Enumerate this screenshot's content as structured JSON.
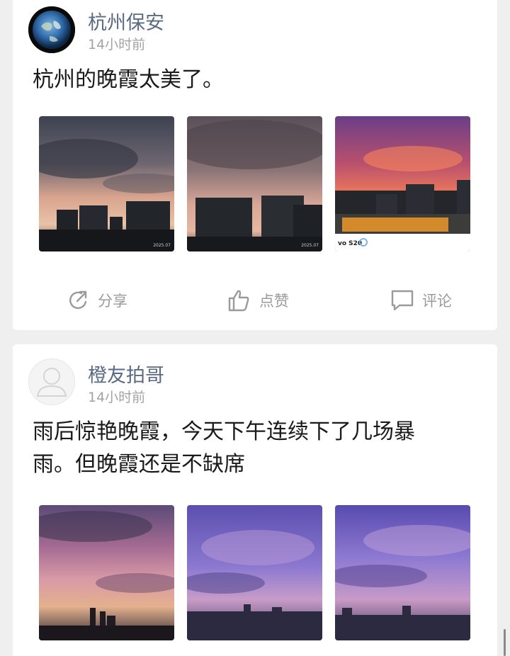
{
  "posts": [
    {
      "username": "杭州保安",
      "time": "14小时前",
      "content": "杭州的晚霞太美了。",
      "photo_captions": [
        "2025.07",
        "2025.07",
        "vo S20"
      ],
      "actions": {
        "share": "分享",
        "like": "点赞",
        "comment": "评论"
      }
    },
    {
      "username": "橙友拍哥",
      "time": "14小时前",
      "content_line1": "雨后惊艳晚霞，今天下午连续下了几场暴",
      "content_line2": "雨。但晚霞还是不缺席"
    }
  ],
  "colors": {
    "background": "#efefef",
    "card": "#ffffff",
    "username": "#5a6a85",
    "meta": "#a3a3a3",
    "text": "#1a1a1a",
    "action": "#9a9a9a"
  }
}
